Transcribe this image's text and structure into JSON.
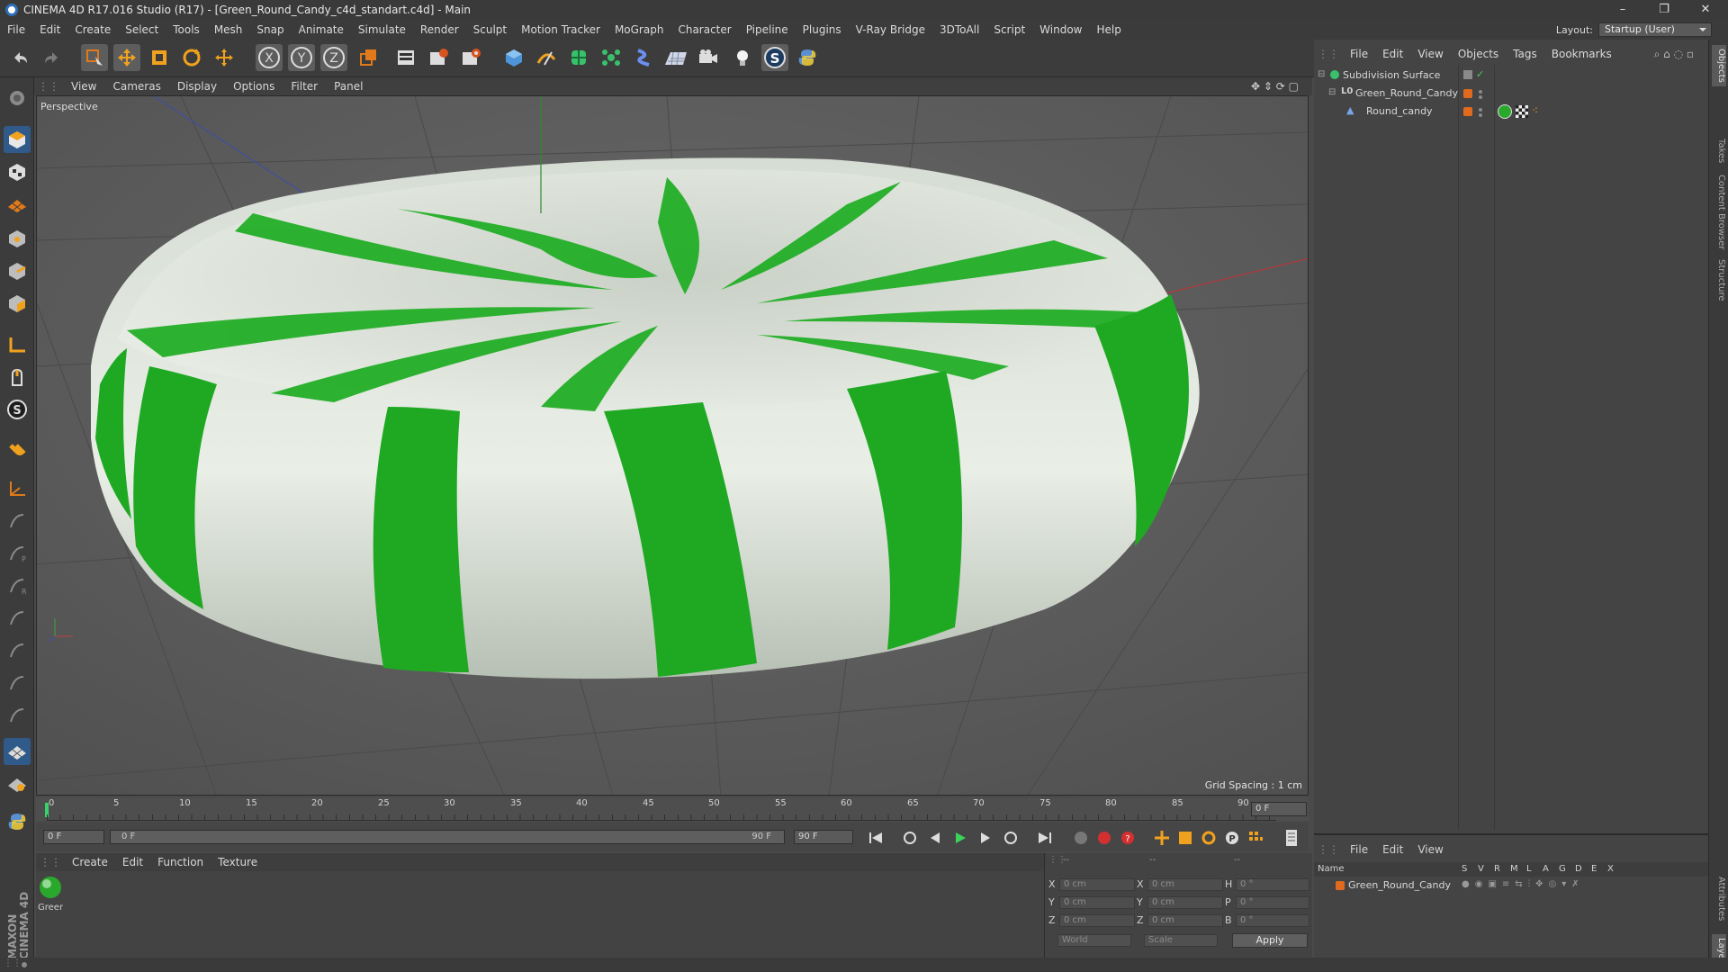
{
  "window": {
    "title": "CINEMA 4D R17.016 Studio (R17) - [Green_Round_Candy_c4d_standart.c4d] - Main",
    "minimize": "–",
    "restore": "❐",
    "close": "✕"
  },
  "menubar": {
    "items": [
      "File",
      "Edit",
      "Create",
      "Select",
      "Tools",
      "Mesh",
      "Snap",
      "Animate",
      "Simulate",
      "Render",
      "Sculpt",
      "Motion Tracker",
      "MoGraph",
      "Character",
      "Pipeline",
      "Plugins",
      "V-Ray Bridge",
      "3DToAll",
      "Script",
      "Window",
      "Help"
    ],
    "layout_label": "Layout:",
    "layout_value": "Startup (User)"
  },
  "toolbar": {
    "icons": [
      "undo-icon",
      "redo-icon",
      "live-selection-icon",
      "move-icon",
      "scale-icon",
      "rotate-icon",
      "move-all-icon",
      "x-axis-icon",
      "y-axis-icon",
      "z-axis-icon",
      "world-coordinates-icon",
      "render-view-icon",
      "render-picture-viewer-icon",
      "edit-render-settings-icon",
      "cube-icon",
      "pen-spline-icon",
      "subdivision-icon",
      "array-icon",
      "deformer-icon",
      "floor-icon",
      "camera-icon",
      "light-icon",
      "script-icon",
      "python-icon"
    ],
    "axis_labels": [
      "X",
      "Y",
      "Z"
    ]
  },
  "viewport": {
    "menu": [
      "View",
      "Cameras",
      "Display",
      "Options",
      "Filter",
      "Panel"
    ],
    "label": "Perspective",
    "grid_spacing": "Grid Spacing : 1 cm"
  },
  "timeline": {
    "ticks": [
      "0",
      "5",
      "10",
      "15",
      "20",
      "25",
      "30",
      "35",
      "40",
      "45",
      "50",
      "55",
      "60",
      "65",
      "70",
      "75",
      "80",
      "85",
      "90"
    ],
    "current_frame": "0 F",
    "start_field": "0 F",
    "slider_start": "0 F",
    "slider_end": "90 F",
    "end_field": "90 F"
  },
  "materials": {
    "menu": [
      "Create",
      "Edit",
      "Function",
      "Texture"
    ],
    "items": [
      {
        "name": "Green"
      }
    ]
  },
  "coordinates": {
    "header": [
      "--",
      "--",
      "--"
    ],
    "rows": [
      {
        "a_label": "X",
        "a_value": "0 cm",
        "b_label": "X",
        "b_value": "0 cm",
        "c_label": "H",
        "c_value": "0 °"
      },
      {
        "a_label": "Y",
        "a_value": "0 cm",
        "b_label": "Y",
        "b_value": "0 cm",
        "c_label": "P",
        "c_value": "0 °"
      },
      {
        "a_label": "Z",
        "a_value": "0 cm",
        "b_label": "Z",
        "b_value": "0 cm",
        "c_label": "B",
        "c_value": "0 °"
      }
    ],
    "mode": "World",
    "transform": "Scale",
    "apply": "Apply"
  },
  "objects": {
    "menu": [
      "File",
      "Edit",
      "View",
      "Objects",
      "Tags",
      "Bookmarks"
    ],
    "tree": [
      {
        "name": "Subdivision Surface",
        "indent": 0
      },
      {
        "name": "Green_Round_Candy",
        "indent": 1
      },
      {
        "name": "Round_candy",
        "indent": 2
      }
    ]
  },
  "attributes": {
    "menu": [
      "File",
      "Edit",
      "View"
    ],
    "columns": [
      "Name",
      "S",
      "V",
      "R",
      "M",
      "L",
      "A",
      "G",
      "D",
      "E",
      "X"
    ],
    "rows": [
      {
        "name": "Green_Round_Candy"
      }
    ]
  },
  "right_tabs": [
    "Objects",
    "Takes",
    "Content Browser",
    "Structure",
    "Attributes",
    "Layers"
  ],
  "colors": {
    "candy_green": "#1fae23",
    "candy_white": "#e4ece2",
    "accent_blue": "#2f5a8a",
    "layer_orange": "#e06b1f"
  }
}
